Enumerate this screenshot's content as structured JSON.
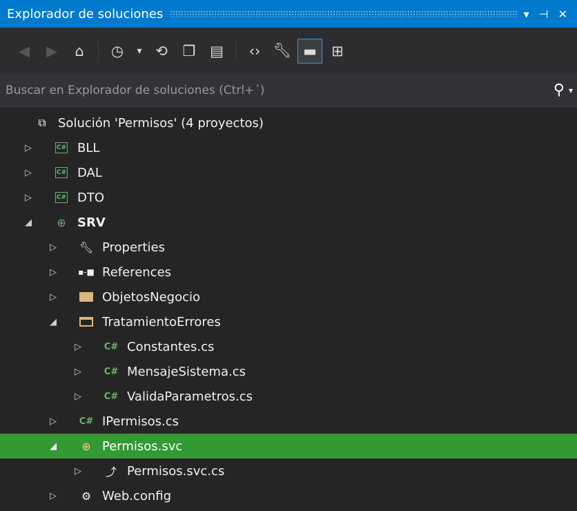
{
  "panel": {
    "title": "Explorador de soluciones",
    "title_buttons": [
      "▾",
      "⊣",
      "✕"
    ]
  },
  "toolbar": {
    "buttons": [
      "back-icon",
      "forward-icon",
      "home-icon",
      "pending-changes-icon",
      "sync-icon",
      "collapse-all-icon",
      "show-all-files-icon",
      "view-code-icon",
      "properties-icon",
      "preview-icon",
      "class-view-icon"
    ]
  },
  "search": {
    "placeholder": "Buscar en Explorador de soluciones (Ctrl+´)"
  },
  "tree": {
    "solution": "Solución 'Permisos'  (4 proyectos)",
    "items": [
      {
        "label": "BLL"
      },
      {
        "label": "DAL"
      },
      {
        "label": "DTO"
      },
      {
        "label": "SRV"
      },
      {
        "label": "Properties"
      },
      {
        "label": "References"
      },
      {
        "label": "ObjetosNegocio"
      },
      {
        "label": "TratamientoErrores"
      },
      {
        "label": "Constantes.cs"
      },
      {
        "label": "MensajeSistema.cs"
      },
      {
        "label": "ValidaParametros.cs"
      },
      {
        "label": "IPermisos.cs"
      },
      {
        "label": "Permisos.svc"
      },
      {
        "label": "Permisos.svc.cs"
      },
      {
        "label": "Web.config"
      }
    ]
  },
  "colors": {
    "accent": "#007acc",
    "selection": "#339933",
    "background": "#252526"
  }
}
